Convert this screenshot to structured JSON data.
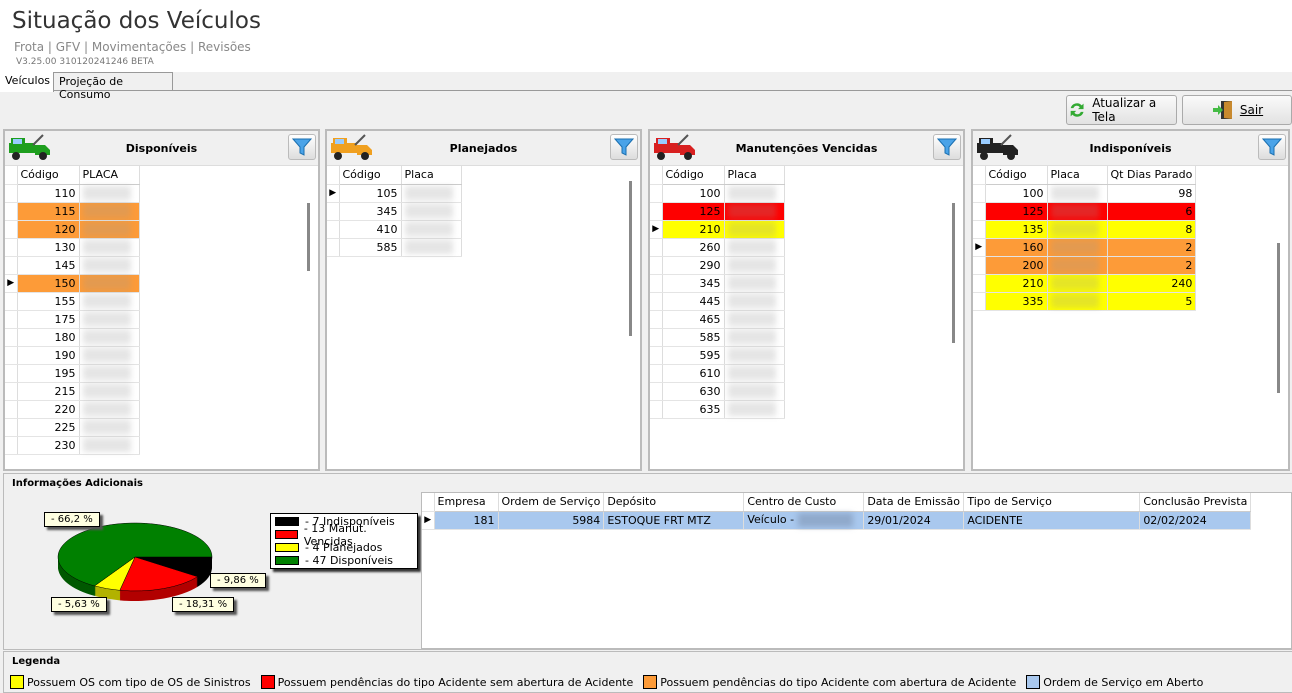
{
  "header": {
    "title": "Situação dos Veículos",
    "subtitle": "Frota | GFV | Movimentações | Revisões",
    "version": "V3.25.00 310120241246 BETA"
  },
  "tabs": [
    {
      "label": "Veículos",
      "active": true
    },
    {
      "label": "Projeção de Consumo",
      "active": false
    }
  ],
  "toolbar": {
    "refresh_label": "Atualizar a Tela",
    "exit_label": "Sair"
  },
  "panels": {
    "disponiveis": {
      "title": "Disponíveis",
      "truck_color": "#1e9e1e",
      "columns": [
        "Código",
        "PLACA"
      ],
      "selected_index": 5,
      "rows": [
        {
          "codigo": "110",
          "color": "white"
        },
        {
          "codigo": "115",
          "color": "orange"
        },
        {
          "codigo": "120",
          "color": "orange"
        },
        {
          "codigo": "130",
          "color": "white"
        },
        {
          "codigo": "145",
          "color": "white"
        },
        {
          "codigo": "150",
          "color": "orange"
        },
        {
          "codigo": "155",
          "color": "white"
        },
        {
          "codigo": "175",
          "color": "white"
        },
        {
          "codigo": "180",
          "color": "white"
        },
        {
          "codigo": "190",
          "color": "white"
        },
        {
          "codigo": "195",
          "color": "white"
        },
        {
          "codigo": "215",
          "color": "white"
        },
        {
          "codigo": "220",
          "color": "white"
        },
        {
          "codigo": "225",
          "color": "white"
        },
        {
          "codigo": "230",
          "color": "white"
        }
      ]
    },
    "planejados": {
      "title": "Planejados",
      "truck_color": "#f0a020",
      "columns": [
        "Código",
        "Placa"
      ],
      "selected_index": 0,
      "rows": [
        {
          "codigo": "105",
          "color": "white"
        },
        {
          "codigo": "345",
          "color": "white"
        },
        {
          "codigo": "410",
          "color": "white"
        },
        {
          "codigo": "585",
          "color": "white"
        }
      ]
    },
    "manutencoes": {
      "title": "Manutenções Vencidas",
      "truck_color": "#d82020",
      "columns": [
        "Código",
        "Placa"
      ],
      "selected_index": 2,
      "rows": [
        {
          "codigo": "100",
          "color": "white"
        },
        {
          "codigo": "125",
          "color": "red"
        },
        {
          "codigo": "210",
          "color": "yellow"
        },
        {
          "codigo": "260",
          "color": "white"
        },
        {
          "codigo": "290",
          "color": "white"
        },
        {
          "codigo": "345",
          "color": "white"
        },
        {
          "codigo": "445",
          "color": "white"
        },
        {
          "codigo": "465",
          "color": "white"
        },
        {
          "codigo": "585",
          "color": "white"
        },
        {
          "codigo": "595",
          "color": "white"
        },
        {
          "codigo": "610",
          "color": "white"
        },
        {
          "codigo": "630",
          "color": "white"
        },
        {
          "codigo": "635",
          "color": "white"
        }
      ]
    },
    "indisponiveis": {
      "title": "Indisponíveis",
      "truck_color": "#222222",
      "columns": [
        "Código",
        "Placa",
        "Qt Dias Parado"
      ],
      "selected_index": 3,
      "rows": [
        {
          "codigo": "100",
          "dias": "98",
          "color": "white"
        },
        {
          "codigo": "125",
          "dias": "6",
          "color": "red"
        },
        {
          "codigo": "135",
          "dias": "8",
          "color": "yellow"
        },
        {
          "codigo": "160",
          "dias": "2",
          "color": "orange"
        },
        {
          "codigo": "200",
          "dias": "2",
          "color": "orange"
        },
        {
          "codigo": "210",
          "dias": "240",
          "color": "yellow"
        },
        {
          "codigo": "335",
          "dias": "5",
          "color": "yellow"
        }
      ]
    }
  },
  "info": {
    "title": "Informações Adicionais",
    "chart_data": {
      "type": "pie",
      "three_d": true,
      "slices": [
        {
          "label": "- 7 Indisponíveis",
          "value": 7,
          "percent_label": "- 9,86 %",
          "color": "#000000"
        },
        {
          "label": "- 13 Manut. Vencidas",
          "value": 13,
          "percent_label": "- 18,31 %",
          "color": "#ff0000"
        },
        {
          "label": "- 4 Planejados",
          "value": 4,
          "percent_label": "- 5,63 %",
          "color": "#ffff00"
        },
        {
          "label": "- 47 Disponíveis",
          "value": 47,
          "percent_label": "- 66,2 %",
          "color": "#008000"
        }
      ],
      "legend": "right"
    },
    "os_table": {
      "columns": [
        "Empresa",
        "Ordem de Serviço",
        "Depósito",
        "Centro de Custo",
        "Data de Emissão",
        "Tipo de Serviço",
        "Conclusão Prevista"
      ],
      "rows": [
        [
          "181",
          "5984",
          "ESTOQUE FRT MTZ",
          "Veículo -",
          "29/01/2024",
          "ACIDENTE",
          "02/02/2024"
        ]
      ]
    }
  },
  "legend": {
    "title": "Legenda",
    "items": [
      {
        "label": "Possuem OS com tipo de OS de Sinistros",
        "color": "#ffff00"
      },
      {
        "label": "Possuem pendências do tipo Acidente sem abertura de Acidente",
        "color": "#ff0000"
      },
      {
        "label": "Possuem pendências do tipo Acidente com abertura de Acidente",
        "color": "#fd9b38"
      },
      {
        "label": "Ordem de Serviço em Aberto",
        "color": "#a9c8ee"
      }
    ]
  }
}
